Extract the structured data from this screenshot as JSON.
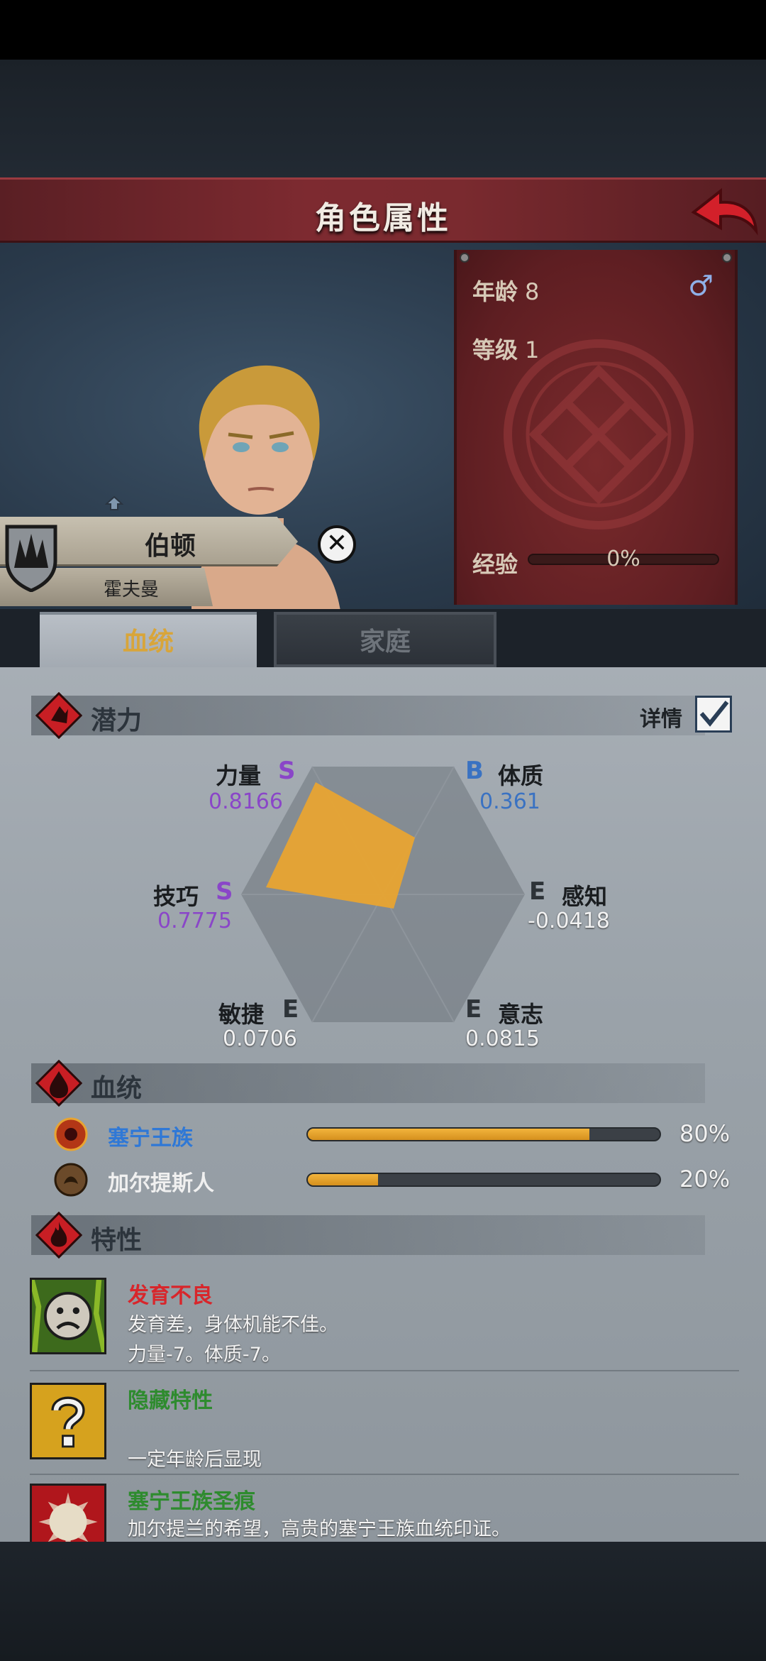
{
  "header": {
    "title": "角色属性"
  },
  "character": {
    "age_label": "年龄",
    "age": "8",
    "level_label": "等级",
    "level": "1",
    "gender_symbol": "♂",
    "exp_label": "经验",
    "exp_text": "0%",
    "exp_progress": 0,
    "first_name": "伯顿",
    "last_name": "霍夫曼"
  },
  "tabs": {
    "bloodline": "血统",
    "family": "家庭"
  },
  "potential": {
    "title": "潜力",
    "detail_label": "详情",
    "detail_checked": true,
    "stats": [
      {
        "name": "力量",
        "grade": "S",
        "value": "0.8166"
      },
      {
        "name": "体质",
        "grade": "B",
        "value": "0.361"
      },
      {
        "name": "感知",
        "grade": "E",
        "value": "-0.0418"
      },
      {
        "name": "意志",
        "grade": "E",
        "value": "0.0815"
      },
      {
        "name": "敏捷",
        "grade": "E",
        "value": "0.0706"
      },
      {
        "name": "技巧",
        "grade": "S",
        "value": "0.7775"
      }
    ]
  },
  "bloodline": {
    "title": "血统",
    "items": [
      {
        "name": "塞宁王族",
        "percent": "80%",
        "fraction": 0.8,
        "color": "#2f78d6"
      },
      {
        "name": "加尔提斯人",
        "percent": "20%",
        "fraction": 0.2,
        "color": "#f0f0f0"
      }
    ]
  },
  "traits": {
    "title": "特性",
    "items": [
      {
        "name": "发育不良",
        "color": "#d8262b",
        "desc1": "发育差，身体机能不佳。",
        "desc2": "力量-7。体质-7。"
      },
      {
        "name": "隐藏特性",
        "color": "#2e8b2e",
        "desc1": "",
        "desc2": "一定年龄后显现"
      },
      {
        "name": "塞宁王族圣痕",
        "color": "#2e8b2e",
        "desc1": "加尔提兰的希望，高贵的塞宁王族血统印证。",
        "desc2": ""
      }
    ]
  }
}
